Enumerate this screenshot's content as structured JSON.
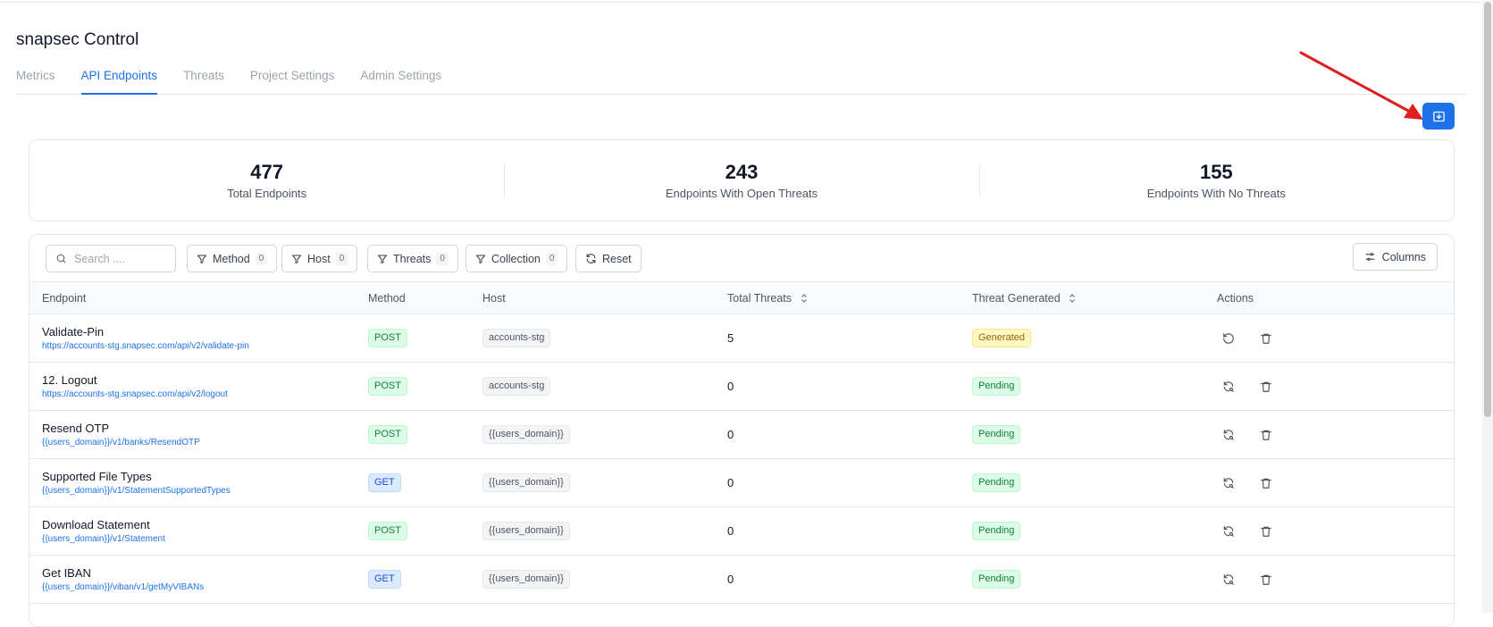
{
  "app": {
    "title": "snapsec Control"
  },
  "tabs": [
    {
      "label": "Metrics",
      "active": false
    },
    {
      "label": "API Endpoints",
      "active": true
    },
    {
      "label": "Threats",
      "active": false
    },
    {
      "label": "Project Settings",
      "active": false
    },
    {
      "label": "Admin Settings",
      "active": false
    }
  ],
  "export_button": {
    "icon": "download-icon"
  },
  "stats": [
    {
      "value": "477",
      "label": "Total Endpoints"
    },
    {
      "value": "243",
      "label": "Endpoints With Open Threats"
    },
    {
      "value": "155",
      "label": "Endpoints With No Threats"
    }
  ],
  "toolbar": {
    "search_placeholder": "Search ....",
    "filters": [
      {
        "label": "Method",
        "count": "0"
      },
      {
        "label": "Host",
        "count": "0"
      },
      {
        "label": "Threats",
        "count": "0"
      },
      {
        "label": "Collection",
        "count": "0"
      }
    ],
    "reset_label": "Reset",
    "columns_label": "Columns"
  },
  "table": {
    "headers": {
      "endpoint": "Endpoint",
      "method": "Method",
      "host": "Host",
      "total_threats": "Total Threats",
      "threat_generated": "Threat Generated",
      "actions": "Actions"
    },
    "rows": [
      {
        "name": "Validate-Pin",
        "url": "https://accounts-stg.snapsec.com/api/v2/validate-pin",
        "method": "POST",
        "host": "accounts-stg",
        "threats": "5",
        "status": "Generated"
      },
      {
        "name": "12. Logout",
        "url": "https://accounts-stg.snapsec.com/api/v2/logout",
        "method": "POST",
        "host": "accounts-stg",
        "threats": "0",
        "status": "Pending"
      },
      {
        "name": "Resend OTP",
        "url": "{{users_domain}}/v1/banks/ResendOTP",
        "method": "POST",
        "host": "{{users_domain}}",
        "threats": "0",
        "status": "Pending"
      },
      {
        "name": "Supported File Types",
        "url": "{{users_domain}}/v1/StatementSupportedTypes",
        "method": "GET",
        "host": "{{users_domain}}",
        "threats": "0",
        "status": "Pending"
      },
      {
        "name": "Download Statement",
        "url": "{{users_domain}}/v1/Statement",
        "method": "POST",
        "host": "{{users_domain}}",
        "threats": "0",
        "status": "Pending"
      },
      {
        "name": "Get IBAN",
        "url": "{{users_domain}}/viban/v1/getMyVIBANs",
        "method": "GET",
        "host": "{{users_domain}}",
        "threats": "0",
        "status": "Pending"
      }
    ]
  },
  "colors": {
    "accent": "#1d72e8",
    "annotation_arrow": "#e11d1d"
  }
}
